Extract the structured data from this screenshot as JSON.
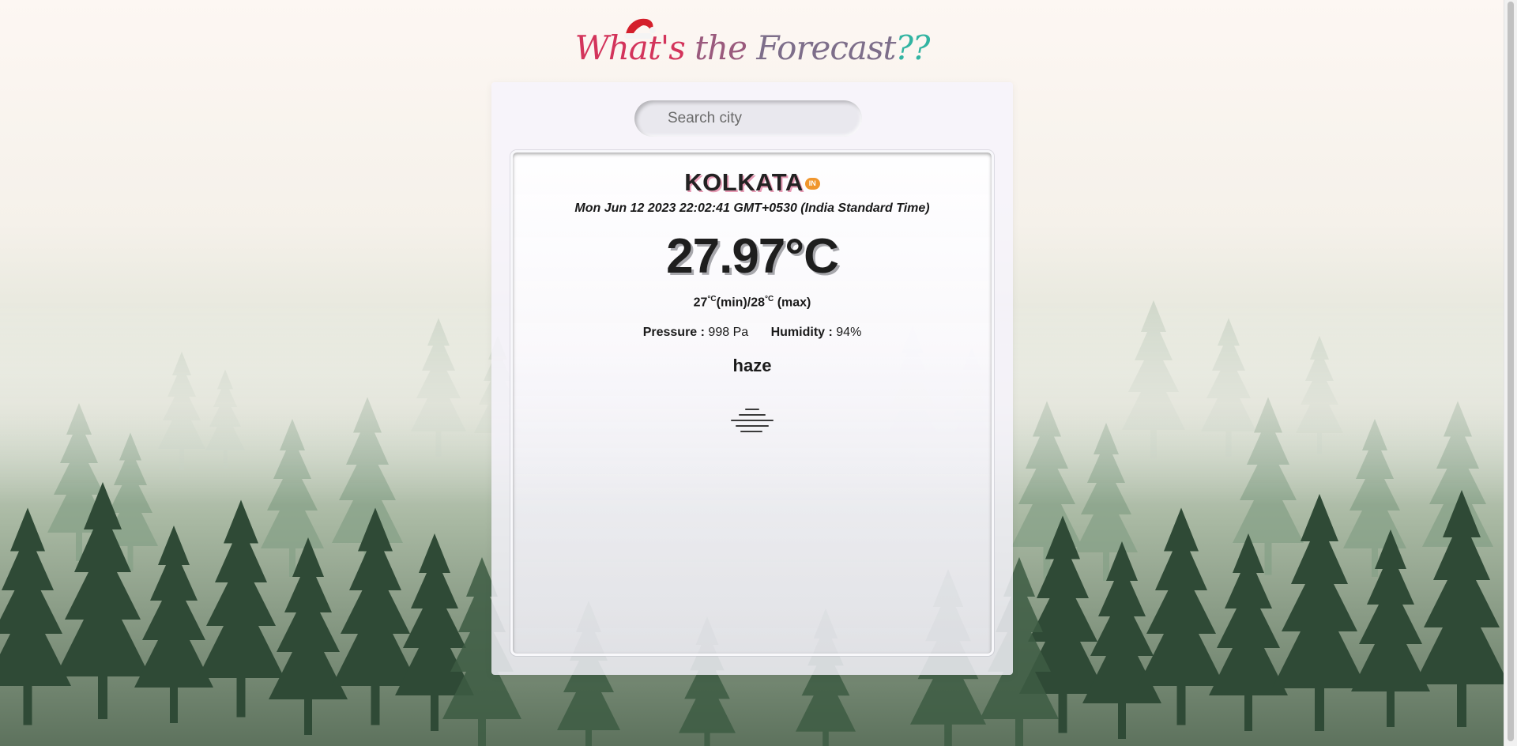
{
  "title": {
    "part1": "What's",
    "part2": "the",
    "part3": "Forecast",
    "part4": "??",
    "hat_icon": "santa-hat-icon"
  },
  "search": {
    "placeholder": "Search city",
    "value": ""
  },
  "weather": {
    "city": "KOLKATA",
    "country_code": "IN",
    "datetime": "Mon Jun 12 2023 22:02:41 GMT+0530 (India Standard Time)",
    "temperature": "27.97°C",
    "min_temp": "27",
    "max_temp": "28",
    "unit_sup": "°C",
    "min_label": "(min)/",
    "max_label": "(max)",
    "pressure_label": "Pressure :",
    "pressure_value": "998 Pa",
    "humidity_label": "Humidity :",
    "humidity_value": "94%",
    "description": "haze",
    "icon": "haze-icon"
  },
  "colors": {
    "title_pink": "#d3345b",
    "title_mauve": "#9a5a7d",
    "title_teal": "#32b4a2",
    "badge_orange": "#f0962d",
    "city_shadow": "#e79bb5"
  }
}
